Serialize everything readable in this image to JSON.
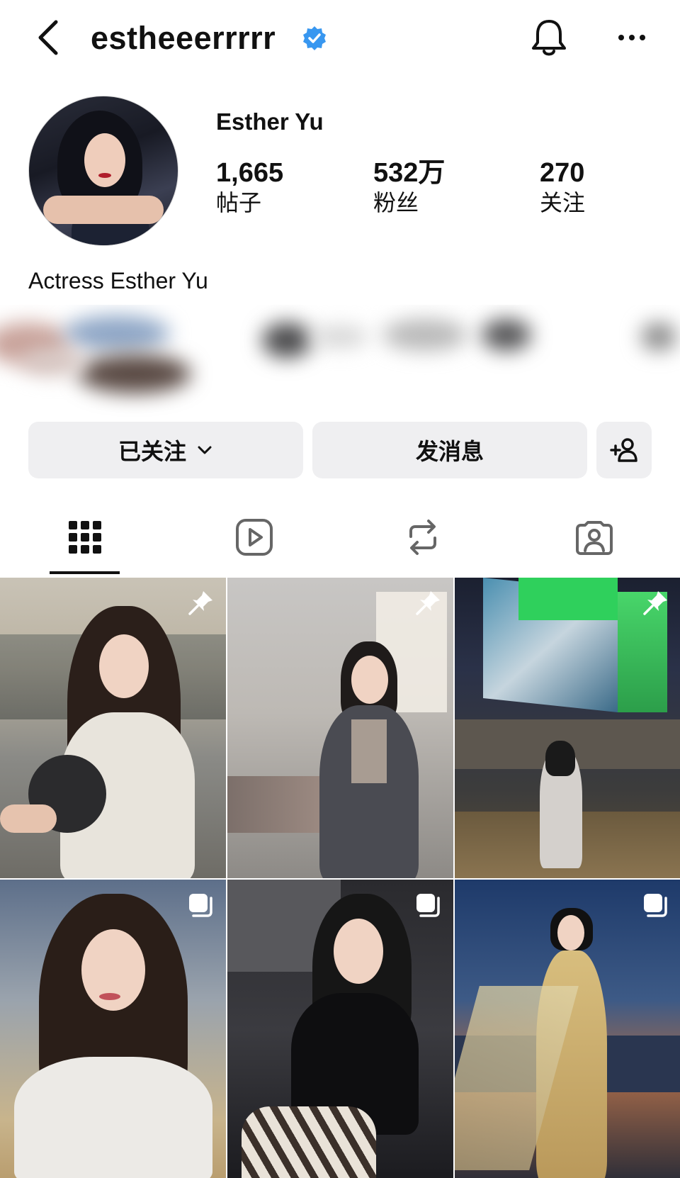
{
  "header": {
    "username": "estheeerrrrr",
    "back_icon": "chevron-left-icon",
    "verified_icon": "verified-badge-icon",
    "bell_icon": "bell-icon",
    "more_icon": "more-horizontal-icon"
  },
  "profile": {
    "full_name": "Esther Yu",
    "stats": [
      {
        "value": "1,665",
        "label": "帖子"
      },
      {
        "value": "532万",
        "label": "粉丝"
      },
      {
        "value": "270",
        "label": "关注"
      }
    ],
    "bio": "Actress Esther Yu"
  },
  "actions": {
    "following_label": "已关注",
    "message_label": "发消息",
    "add_user_icon": "add-person-icon"
  },
  "tabs": [
    {
      "name": "posts",
      "icon": "grid-icon",
      "selected": true
    },
    {
      "name": "reels",
      "icon": "reels-icon",
      "selected": false
    },
    {
      "name": "reposts",
      "icon": "repost-icon",
      "selected": false
    },
    {
      "name": "tagged",
      "icon": "tagged-person-icon",
      "selected": false
    }
  ],
  "grid": [
    {
      "badge": "pin-icon"
    },
    {
      "badge": "pin-icon"
    },
    {
      "badge": "pin-icon"
    },
    {
      "badge": "carousel-icon"
    },
    {
      "badge": "carousel-icon"
    },
    {
      "badge": "carousel-icon"
    }
  ],
  "colors": {
    "verified": "#3897f0",
    "button_bg": "#efeff1",
    "text": "#111111"
  }
}
